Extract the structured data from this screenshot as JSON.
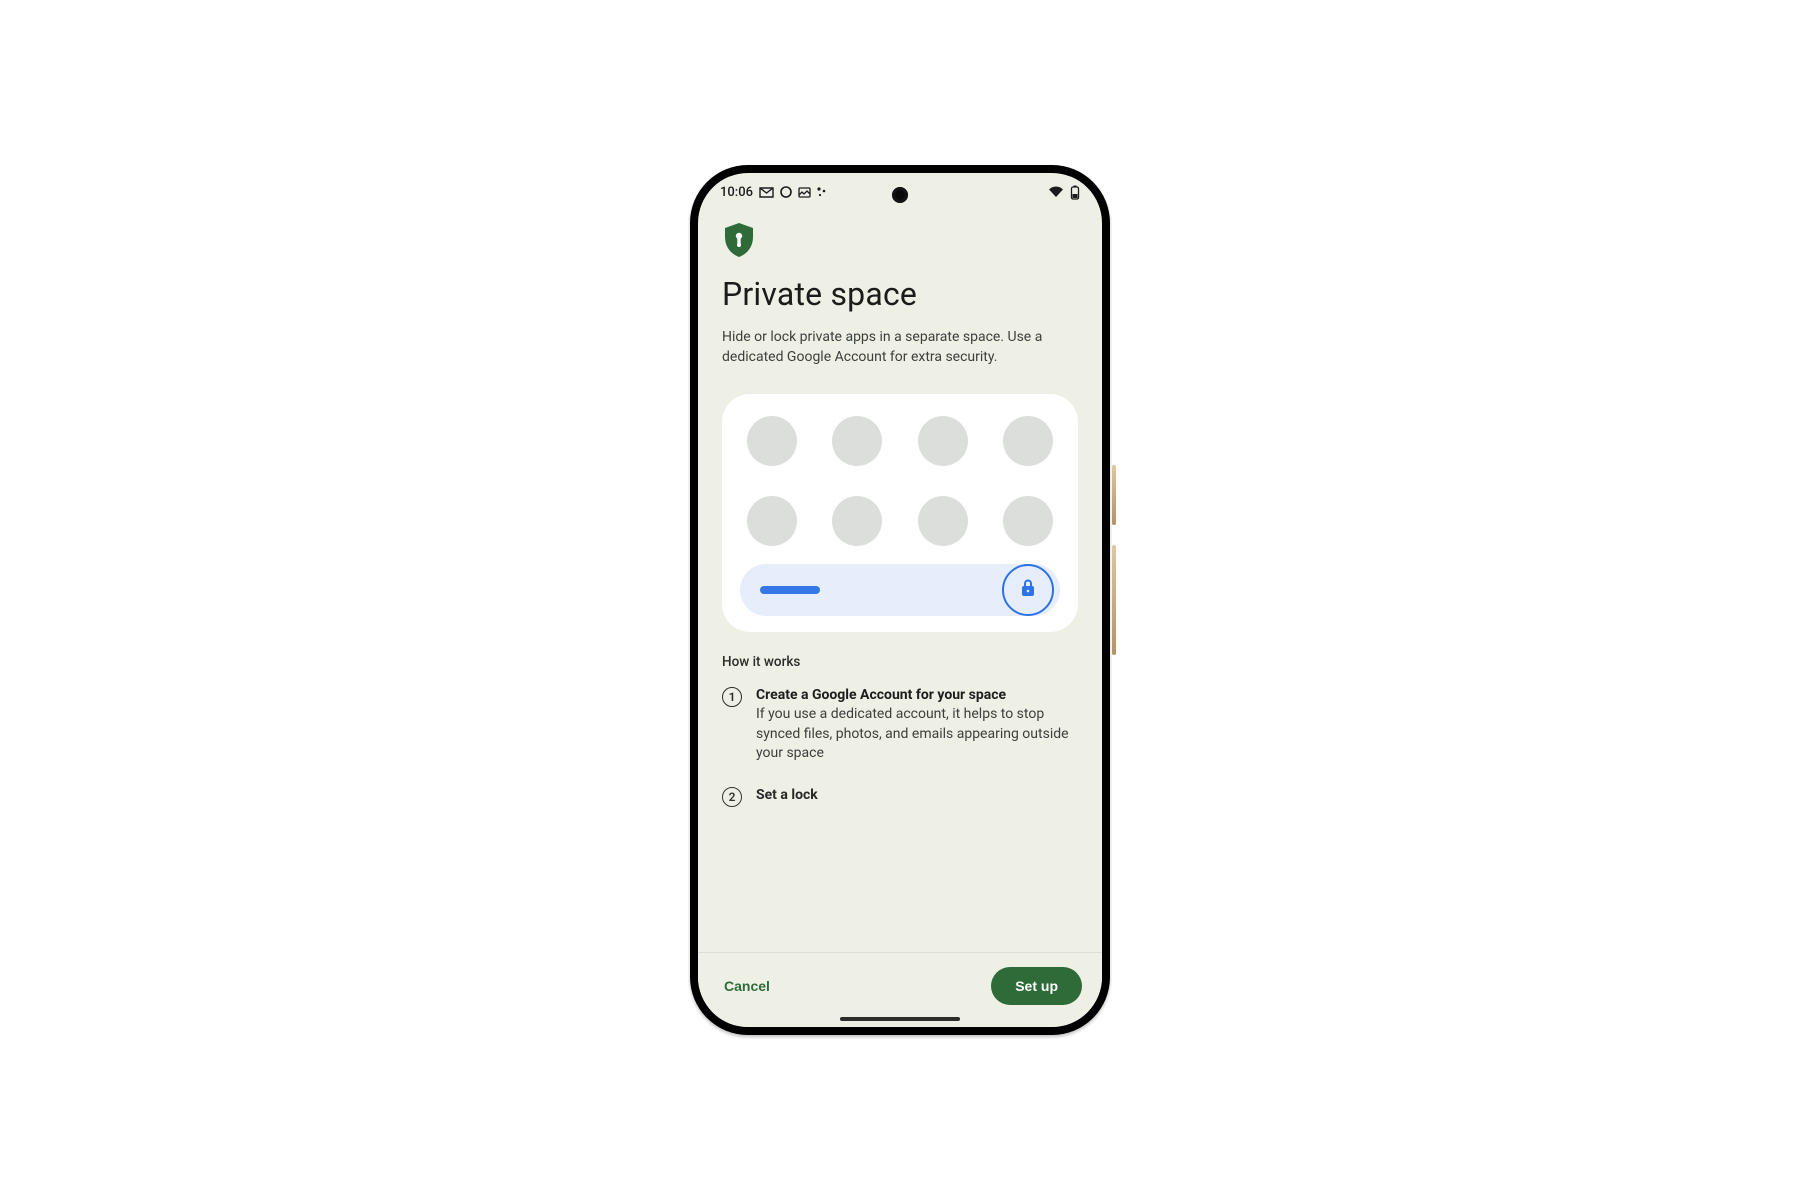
{
  "status_bar": {
    "time": "10:06",
    "left_icons": [
      "gmail-icon",
      "circle-icon",
      "image-icon",
      "dots-icon"
    ],
    "right_icons": [
      "wifi-icon",
      "battery-icon"
    ]
  },
  "page": {
    "title": "Private space",
    "description": "Hide or lock private apps in a separate space. Use a dedicated Google Account for extra security.",
    "how_it_works_label": "How it works",
    "steps": [
      {
        "number": "1",
        "heading": "Create a Google Account for your space",
        "body": "If you use a dedicated account, it helps to stop synced files, photos, and emails appearing outside your space"
      },
      {
        "number": "2",
        "heading": "Set a lock",
        "body": ""
      }
    ]
  },
  "actions": {
    "cancel": "Cancel",
    "setup": "Set up"
  },
  "colors": {
    "screen_bg": "#eef0e6",
    "primary_green": "#2e6b39",
    "illus_blue": "#3477e5",
    "dot_grey": "#dcdedc"
  }
}
